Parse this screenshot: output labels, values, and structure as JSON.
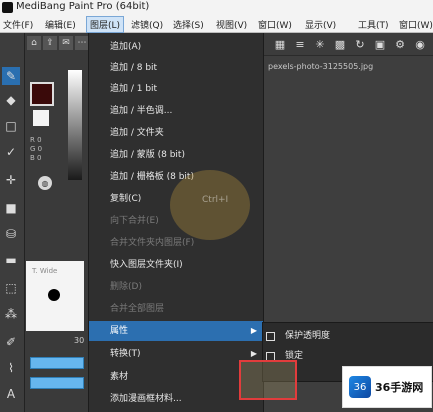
{
  "title": "MediBang Paint Pro (64bit)",
  "menubar": [
    "文件(F)",
    "编辑(E)",
    "图层(L)",
    "滤镜(Q)",
    "选择(S)",
    "视图(V)",
    "窗口(W)",
    "显示(V)",
    "工具(T)",
    "窗口(W)"
  ],
  "active_menu_index": 2,
  "panel": {
    "rgb": [
      "R 0",
      "G 0",
      "B 0"
    ],
    "brush_label": "T. Wide",
    "slider_value": "30"
  },
  "canvas": {
    "filename": "pexels-photo-3125505.jpg"
  },
  "dropdown": {
    "items": [
      {
        "label": "追加(A)",
        "disabled": false
      },
      {
        "label": "追加 / 8 bit",
        "disabled": false
      },
      {
        "label": "追加 / 1 bit",
        "disabled": false
      },
      {
        "label": "追加 / 半色调...",
        "disabled": false
      },
      {
        "label": "追加 / 文件夹",
        "disabled": false
      },
      {
        "label": "追加 / 蒙版 (8 bit)",
        "disabled": false
      },
      {
        "label": "追加 / 栅格板 (8 bit)",
        "disabled": false
      },
      {
        "label": "复制(C)",
        "disabled": false
      },
      {
        "label": "向下合并(E)",
        "disabled": true
      },
      {
        "label": "合并文件夹内图层(F)",
        "disabled": true
      },
      {
        "label": "快入图层文件夹(I)",
        "disabled": false
      },
      {
        "label": "删除(D)",
        "disabled": true
      },
      {
        "label": "合并全部图层",
        "disabled": true
      },
      {
        "label": "属性",
        "disabled": false,
        "highlight": true,
        "submenu": true
      },
      {
        "label": "转换(T)",
        "disabled": false,
        "submenu": true
      },
      {
        "label": "素材",
        "disabled": false
      },
      {
        "label": "添加漫画框材料...",
        "disabled": false
      }
    ]
  },
  "submenu": {
    "items": [
      "保护透明度",
      "锁定"
    ]
  },
  "watermark": "Ctrl+I",
  "logo": {
    "text": "36手游网",
    "mark": "36"
  }
}
